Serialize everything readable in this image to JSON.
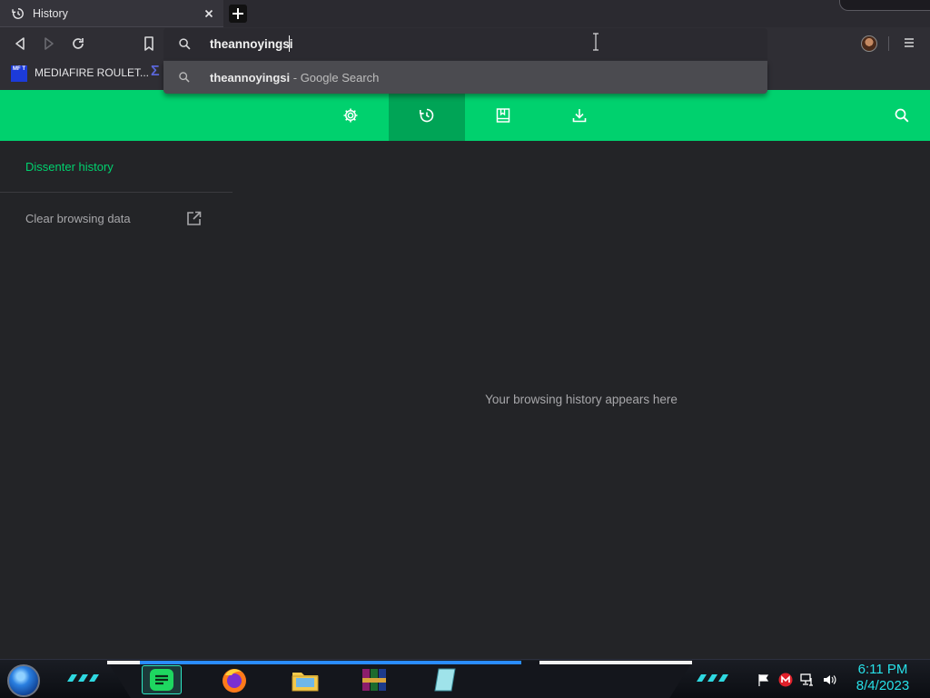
{
  "browser": {
    "tab": {
      "title": "History",
      "icon": "history-icon"
    },
    "omnibox": {
      "text": "theannoyingsi"
    },
    "suggestion": {
      "query": "theannoyingsi",
      "separator": " - ",
      "engine": "Google Search"
    },
    "bookmarks": [
      {
        "label": "MEDIAFIRE ROULET...",
        "favicon_text": "MF T"
      }
    ]
  },
  "history_page": {
    "sidebar": {
      "title": "Dissenter history",
      "clear_label": "Clear browsing data"
    },
    "empty_message": "Your browsing history appears here",
    "nav_tabs": [
      "settings-icon",
      "history-icon",
      "bookmarks-icon",
      "downloads-icon"
    ],
    "accent": "#00d16e"
  },
  "taskbar": {
    "time": "6:11 PM",
    "date": "8/4/2023"
  }
}
